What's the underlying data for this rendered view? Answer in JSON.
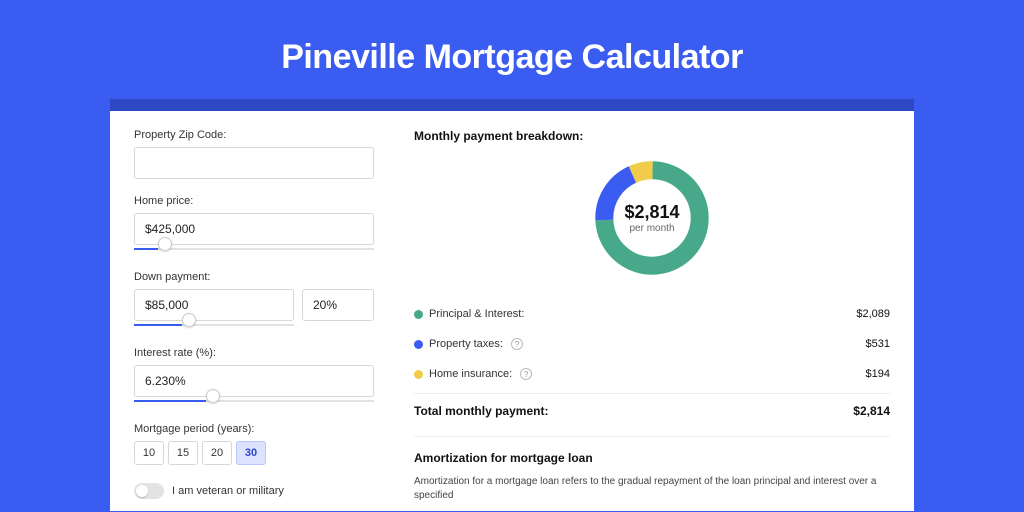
{
  "title": "Pineville Mortgage Calculator",
  "form": {
    "zip": {
      "label": "Property Zip Code:",
      "value": ""
    },
    "home_price": {
      "label": "Home price:",
      "value": "$425,000",
      "slider_fill_pct": 10,
      "knob_pct": 10
    },
    "down_payment": {
      "label": "Down payment:",
      "value": "$85,000",
      "percent": "20%",
      "slider_fill_pct": 20,
      "knob_pct": 20
    },
    "interest_rate": {
      "label": "Interest rate (%):",
      "value": "6.230%",
      "slider_fill_pct": 30,
      "knob_pct": 30
    },
    "period": {
      "label": "Mortgage period (years):",
      "options": [
        "10",
        "15",
        "20",
        "30"
      ],
      "selected": "30"
    },
    "veteran": {
      "label": "I am veteran or military",
      "on": false
    }
  },
  "breakdown": {
    "title": "Monthly payment breakdown:",
    "center_amount": "$2,814",
    "center_sub": "per month",
    "items": [
      {
        "label": "Principal & Interest:",
        "value": "$2,089",
        "color": "green",
        "help": false
      },
      {
        "label": "Property taxes:",
        "value": "$531",
        "color": "blue",
        "help": true
      },
      {
        "label": "Home insurance:",
        "value": "$194",
        "color": "yellow",
        "help": true
      }
    ],
    "total_label": "Total monthly payment:",
    "total_value": "$2,814"
  },
  "amort": {
    "title": "Amortization for mortgage loan",
    "text": "Amortization for a mortgage loan refers to the gradual repayment of the loan principal and interest over a specified"
  },
  "chart_data": {
    "type": "pie",
    "title": "Monthly payment breakdown",
    "series": [
      {
        "name": "Principal & Interest",
        "value": 2089,
        "color": "#47a98a"
      },
      {
        "name": "Property taxes",
        "value": 531,
        "color": "#3b5cf0"
      },
      {
        "name": "Home insurance",
        "value": 194,
        "color": "#f0cc4a"
      }
    ],
    "total": 2814,
    "unit": "USD/month"
  }
}
